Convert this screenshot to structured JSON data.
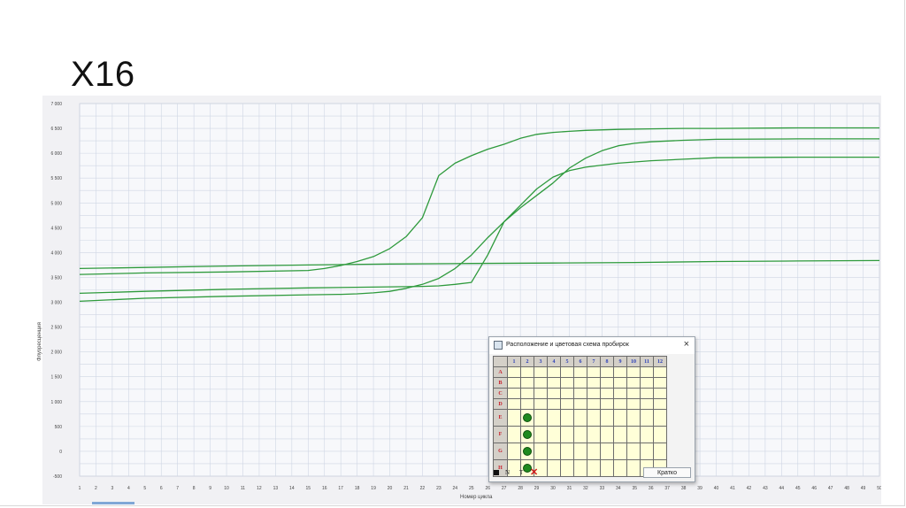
{
  "slide": {
    "title": "X16"
  },
  "chart_data": {
    "type": "line",
    "xlabel": "Номер цикла",
    "ylabel": "Флуоресценция",
    "xlim": [
      1,
      50
    ],
    "ylim": [
      -500,
      7000
    ],
    "y_ticks": [
      "7 000",
      "6 500",
      "6 000",
      "5 500",
      "5 000",
      "4 500",
      "4 000",
      "3 500",
      "3 000",
      "2 500",
      "2 000",
      "1 500",
      "1 000",
      "500",
      "0",
      "-500"
    ],
    "x_ticks": [
      "1",
      "2",
      "3",
      "4",
      "5",
      "6",
      "7",
      "8",
      "9",
      "10",
      "11",
      "12",
      "13",
      "14",
      "15",
      "16",
      "17",
      "18",
      "19",
      "20",
      "21",
      "22",
      "23",
      "24",
      "25",
      "26",
      "27",
      "28",
      "29",
      "30",
      "31",
      "32",
      "33",
      "34",
      "35",
      "36",
      "37",
      "38",
      "39",
      "40",
      "41",
      "42",
      "43",
      "44",
      "45",
      "46",
      "47",
      "48",
      "49",
      "50"
    ],
    "grid": true,
    "line_color": "#2e9a3c",
    "series": [
      {
        "x": [
          1,
          5,
          10,
          15,
          17,
          18,
          19,
          20,
          21,
          22,
          23,
          24,
          25,
          26,
          27,
          28,
          29,
          30,
          31,
          32,
          34,
          36,
          38,
          40,
          45,
          50
        ],
        "y": [
          3020,
          3080,
          3120,
          3150,
          3160,
          3170,
          3190,
          3220,
          3280,
          3360,
          3480,
          3680,
          3950,
          4300,
          4620,
          4950,
          5280,
          5520,
          5650,
          5720,
          5800,
          5850,
          5880,
          5910,
          5920,
          5920
        ]
      },
      {
        "x": [
          1,
          5,
          10,
          15,
          20,
          22,
          23,
          24,
          25,
          26,
          27,
          28,
          29,
          30,
          31,
          32,
          33,
          34,
          35,
          36,
          38,
          40,
          45,
          50
        ],
        "y": [
          3180,
          3220,
          3260,
          3290,
          3310,
          3320,
          3330,
          3360,
          3400,
          3950,
          4620,
          4900,
          5150,
          5400,
          5700,
          5900,
          6050,
          6150,
          6200,
          6230,
          6260,
          6280,
          6290,
          6290
        ]
      },
      {
        "x": [
          1,
          5,
          10,
          15,
          16,
          17,
          18,
          19,
          20,
          21,
          22,
          23,
          24,
          25,
          26,
          27,
          28,
          29,
          30,
          31,
          32,
          34,
          36,
          38,
          40,
          45,
          50
        ],
        "y": [
          3560,
          3590,
          3610,
          3640,
          3680,
          3740,
          3820,
          3920,
          4080,
          4320,
          4700,
          5550,
          5800,
          5950,
          6080,
          6180,
          6300,
          6380,
          6420,
          6440,
          6460,
          6480,
          6490,
          6500,
          6500,
          6510,
          6510
        ]
      },
      {
        "x": [
          1,
          5,
          10,
          15,
          20,
          25,
          30,
          35,
          40,
          45,
          50
        ],
        "y": [
          3680,
          3700,
          3730,
          3750,
          3770,
          3780,
          3790,
          3800,
          3820,
          3830,
          3840
        ]
      }
    ]
  },
  "dialog": {
    "title": "Расположение и цветовая схема пробирок",
    "close": "×",
    "columns": [
      "1",
      "2",
      "3",
      "4",
      "5",
      "6",
      "7",
      "8",
      "9",
      "10",
      "11",
      "12"
    ],
    "rows": [
      "A",
      "B",
      "C",
      "D",
      "E",
      "F",
      "G",
      "H"
    ],
    "filled_wells": [
      "E2",
      "F2",
      "G2",
      "H2"
    ],
    "well_color": "#1f8a1f",
    "footer_n": "N",
    "footer_t": "T",
    "footer_x": "✕",
    "button": "Кратко"
  }
}
